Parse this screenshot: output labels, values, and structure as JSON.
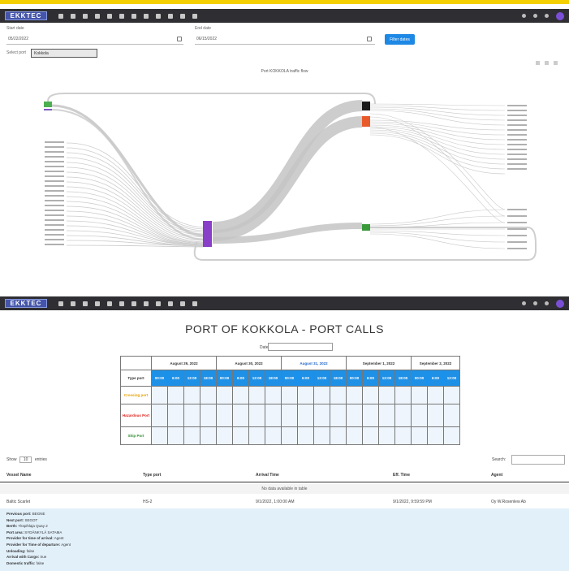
{
  "top_nav": {
    "logo": "EKKTEC",
    "icon_count": 12
  },
  "filters": {
    "start_label": "Start date",
    "start_value": "05/22/2022",
    "end_label": "End date",
    "end_value": "06/15/2022",
    "filter_button": "Filter dates",
    "port_label": "Select port",
    "port_value": "Kokkola"
  },
  "chart": {
    "title": "Port KOKKOLA traffic flow"
  },
  "page": {
    "title": "PORT OF KOKKOLA - PORT CALLS",
    "date_label": "Date"
  },
  "schedule": {
    "dates": [
      "August 29, 2022",
      "August 30, 2022",
      "August 31, 2022",
      "September 1, 2022",
      "September 2, 2022"
    ],
    "highlight_index": 2,
    "row_type_port": "Type port",
    "time_slots": [
      "00:00",
      "6:00",
      "12:00",
      "18:00",
      "00:00",
      "6:00",
      "12:00",
      "18:00",
      "00:00",
      "6:00",
      "12:00",
      "18:00",
      "00:00",
      "6:00",
      "12:00",
      "18:00",
      "00:00",
      "6:00",
      "12:00"
    ],
    "rows": [
      {
        "label": "Crossing port",
        "color": "#e6a100"
      },
      {
        "label": "Hazardous Port",
        "color": "#e0201a"
      },
      {
        "label": "Ship Port",
        "color": "#2e8b2e"
      }
    ]
  },
  "datatable": {
    "show_prefix": "Show",
    "show_value": "10",
    "show_suffix": "entries",
    "search_label": "Search:",
    "columns": [
      "Vessel Name",
      "Type port",
      "Arrival Time",
      "Eff. Time",
      "Agent"
    ],
    "empty_text": "No data available in table",
    "row": {
      "vessel": "Baltic Scarlet",
      "type": "HS-2",
      "arrival": "9/1/2022, 1:00:00 AM",
      "eff": "9/1/2022, 9:59:59 PM",
      "agent": "Oy W.Rosenlew Ab"
    }
  },
  "details": [
    {
      "key": "Previous port:",
      "value": "BEGNE"
    },
    {
      "key": "Next port:",
      "value": "SEGOT"
    },
    {
      "key": "Berth:",
      "value": "Ykspihlaja Quay 2"
    },
    {
      "key": "Port area:",
      "value": "SYDÄNKYLÄ SATAMA"
    },
    {
      "key": "Provider for time of arrival:",
      "value": "Agent"
    },
    {
      "key": "Provider for Time of departure:",
      "value": "Agent"
    },
    {
      "key": "Unloading:",
      "value": "false"
    },
    {
      "key": "Arrival with Cargo:",
      "value": "true"
    },
    {
      "key": "Domestic traffic:",
      "value": "false"
    }
  ],
  "colors": {
    "nav_bg": "#2f2f33",
    "accent_blue": "#1e88e5",
    "node_purple": "#8a3fc8",
    "node_black": "#1a1a1a",
    "node_orange": "#e85a2a",
    "node_green": "#3a9a3a",
    "flow_gray": "#c8c8c8"
  }
}
